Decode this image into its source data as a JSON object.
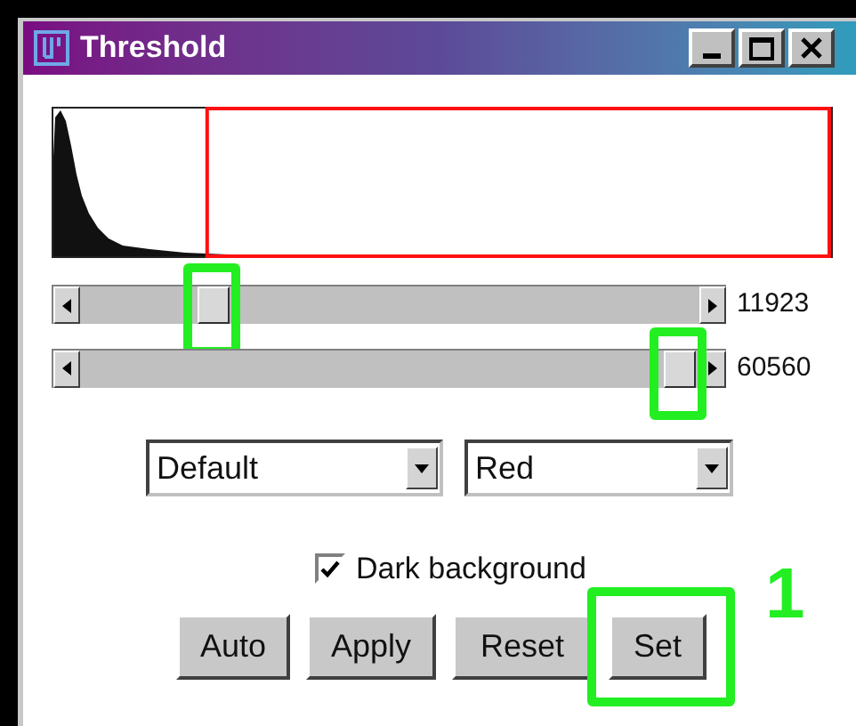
{
  "window": {
    "title": "Threshold"
  },
  "sliders": [
    {
      "level": 0.2,
      "reading": "11923",
      "highlighted": true
    },
    {
      "level": 0.99,
      "reading": "60560",
      "highlighted": true
    }
  ],
  "dropdowns": [
    {
      "value": "Default"
    },
    {
      "value": "Red"
    }
  ],
  "checkbox": {
    "label": "Dark background",
    "checked": true
  },
  "buttons": [
    {
      "label": "Auto",
      "highlighted": false
    },
    {
      "label": "Apply",
      "highlighted": false
    },
    {
      "label": "Reset",
      "highlighted": false
    },
    {
      "label": "Set",
      "highlighted": true
    }
  ],
  "callout_label": "1"
}
